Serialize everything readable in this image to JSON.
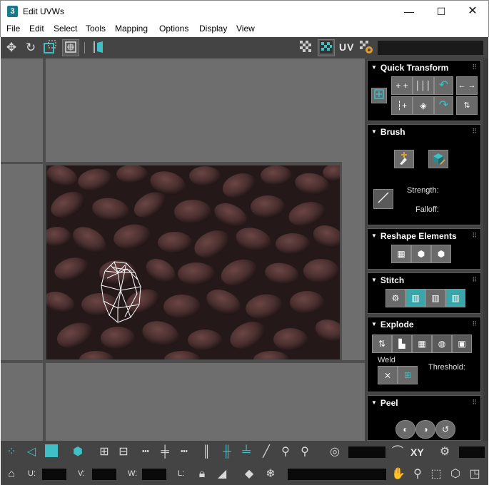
{
  "window": {
    "app_icon": "3",
    "title": "Edit UVWs",
    "minimize_glyph": "—",
    "maximize_glyph": "☐",
    "close_glyph": "✕"
  },
  "menu": [
    "File",
    "Edit",
    "Select",
    "Tools",
    "Mapping",
    "Options",
    "Display",
    "View"
  ],
  "toolbar_top": {
    "uv_label": "UV",
    "icons": [
      "move-icon",
      "rotate-icon",
      "scale-icon",
      "freeform-icon",
      "mirror-icon",
      "checker-icon",
      "checker-pattern-icon",
      "uv-settings-icon"
    ]
  },
  "panel": {
    "quick_transform": {
      "title": "Quick Transform"
    },
    "brush": {
      "title": "Brush",
      "strength_label": "Strength:",
      "falloff_label": "Falloff:"
    },
    "reshape": {
      "title": "Reshape Elements"
    },
    "stitch": {
      "title": "Stitch"
    },
    "explode": {
      "title": "Explode",
      "weld_label": "Weld",
      "threshold_label": "Threshold:"
    },
    "peel": {
      "title": "Peel"
    }
  },
  "bottom": {
    "xy_label": "XY",
    "u_label": "U:",
    "v_label": "V:",
    "w_label": "W:",
    "l_label": "L:"
  },
  "colors": {
    "accent_teal": "#3aa6aa",
    "panel_bg": "#444444",
    "viewport_bg": "#6e6e6e"
  }
}
